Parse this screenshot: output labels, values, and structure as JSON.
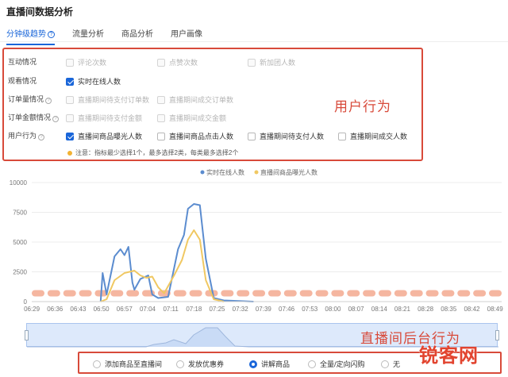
{
  "page": {
    "title": "直播间数据分析"
  },
  "tabs": [
    {
      "label": "分钟级趋势",
      "active": true
    },
    {
      "label": "流量分析"
    },
    {
      "label": "商品分析"
    },
    {
      "label": "用户画像"
    }
  ],
  "filters": {
    "rows": [
      {
        "label": "互动情况",
        "options": [
          {
            "label": "评论次数",
            "state": "disabled"
          },
          {
            "label": "点赞次数",
            "state": "disabled"
          },
          {
            "label": "新加团人数",
            "state": "disabled"
          }
        ]
      },
      {
        "label": "观看情况",
        "options": [
          {
            "label": "实时在线人数",
            "state": "checked"
          }
        ]
      },
      {
        "label": "订单量情况",
        "options": [
          {
            "label": "直播期间待支付订单数",
            "state": "disabled"
          },
          {
            "label": "直播期间成交订单数",
            "state": "disabled"
          }
        ]
      },
      {
        "label": "订单金额情况",
        "options": [
          {
            "label": "直播期间待支付金额",
            "state": "disabled"
          },
          {
            "label": "直播期间成交金额",
            "state": "disabled"
          }
        ]
      },
      {
        "label": "用户行为",
        "options": [
          {
            "label": "直播间商品曝光人数",
            "state": "checked"
          },
          {
            "label": "直播间商品点击人数",
            "state": "enabled"
          },
          {
            "label": "直播期间待支付人数",
            "state": "enabled"
          },
          {
            "label": "直播期间成交人数",
            "state": "enabled"
          }
        ]
      }
    ],
    "note": "注意：指标最少选择1个，最多选择2类，每类最多选择2个",
    "annotation": "用户行为"
  },
  "chart_data": {
    "type": "line",
    "x": [
      "06:29",
      "06:36",
      "06:43",
      "06:50",
      "06:57",
      "07:04",
      "07:11",
      "07:18",
      "07:25",
      "07:32",
      "07:39",
      "07:46",
      "07:53",
      "08:00",
      "08:07",
      "08:14",
      "08:21",
      "08:28",
      "08:35",
      "08:42",
      "08:49"
    ],
    "ylim": [
      0,
      10000
    ],
    "yticks": [
      "0",
      "2500",
      "5000",
      "7500",
      "10000"
    ],
    "grid": true,
    "legend_position": "top-center",
    "series": [
      {
        "name": "实时在线人数",
        "color": "#5b8ccf",
        "points": [
          [
            6.83,
            0
          ],
          [
            6.84,
            2400
          ],
          [
            6.86,
            600
          ],
          [
            6.9,
            3800
          ],
          [
            6.93,
            4400
          ],
          [
            6.95,
            3900
          ],
          [
            6.97,
            4600
          ],
          [
            6.99,
            1600
          ],
          [
            7.0,
            1000
          ],
          [
            7.03,
            1900
          ],
          [
            7.07,
            2200
          ],
          [
            7.09,
            600
          ],
          [
            7.12,
            300
          ],
          [
            7.17,
            400
          ],
          [
            7.22,
            4400
          ],
          [
            7.25,
            5600
          ],
          [
            7.27,
            7800
          ],
          [
            7.3,
            8200
          ],
          [
            7.33,
            8100
          ],
          [
            7.36,
            3600
          ],
          [
            7.4,
            300
          ],
          [
            7.45,
            100
          ],
          [
            7.6,
            0
          ]
        ]
      },
      {
        "name": "直播间商品曝光人数",
        "color": "#f0c862",
        "points": [
          [
            6.83,
            0
          ],
          [
            6.86,
            200
          ],
          [
            6.9,
            1800
          ],
          [
            6.95,
            2400
          ],
          [
            7.0,
            2600
          ],
          [
            7.03,
            2200
          ],
          [
            7.06,
            2000
          ],
          [
            7.09,
            2100
          ],
          [
            7.12,
            1200
          ],
          [
            7.15,
            700
          ],
          [
            7.2,
            2200
          ],
          [
            7.24,
            3500
          ],
          [
            7.27,
            5200
          ],
          [
            7.3,
            6000
          ],
          [
            7.33,
            5200
          ],
          [
            7.36,
            1800
          ],
          [
            7.4,
            200
          ],
          [
            7.45,
            0
          ]
        ]
      }
    ]
  },
  "event_bubbles": {
    "color": "#f3a98f",
    "count": 30
  },
  "annotations": {
    "backend": "直播间后台行为"
  },
  "actions": [
    {
      "label": "添加商品至直播间",
      "selected": false
    },
    {
      "label": "发放优惠券",
      "selected": false
    },
    {
      "label": "讲解商品",
      "selected": true
    },
    {
      "label": "全量/定向闪购",
      "selected": false
    },
    {
      "label": "无",
      "selected": false
    }
  ],
  "watermark": "锐客网"
}
